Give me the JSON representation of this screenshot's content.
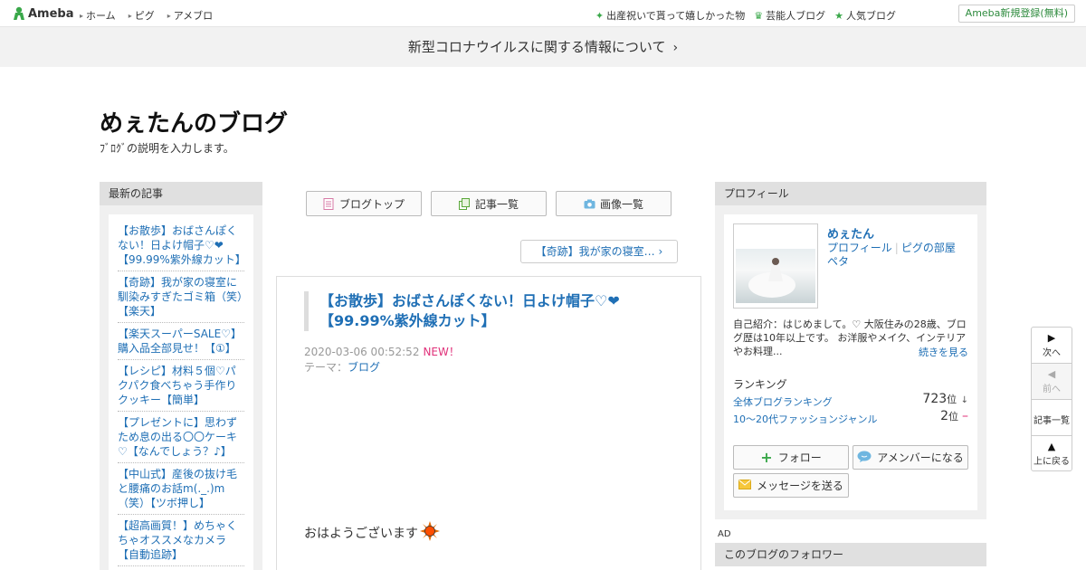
{
  "header": {
    "logo_text": "Ameba",
    "nav": [
      "ホーム",
      "ピグ",
      "アメブロ"
    ],
    "links": [
      "出産祝いで貰って嬉しかった物",
      "芸能人ブログ",
      "人気ブログ"
    ],
    "register_label": "Ameba新規登録(無料)"
  },
  "notice": {
    "text": "新型コロナウイルスに関する情報について",
    "chevron": "›"
  },
  "blog": {
    "title": "めぇたんのブログ",
    "description": "ﾌﾞﾛｸﾞの説明を入力します。"
  },
  "left": {
    "heading": "最新の記事",
    "entries": [
      "【お散歩】おばさんぽくない！日よけ帽子♡❤【99.99%紫外線カット】",
      "【奇跡】我が家の寝室に馴染みすぎたゴミ箱（笑）【楽天】",
      "【楽天スーパーSALE♡】購入品全部見せ！【①】",
      "【レシピ】材料５個♡パクパク食べちゃう手作りクッキー【簡単】",
      "【プレゼントに】思わずため息の出る〇〇ケーキ♡【なんでしょう？♪】",
      "【中山式】産後の抜け毛と腰痛のお話m(._.)m（笑）【ツボ押し】",
      "【超高画質！】めちゃくちゃオススメなカメラ【自動追跡】"
    ]
  },
  "tabs": {
    "top": "ブログトップ",
    "list": "記事一覧",
    "images": "画像一覧"
  },
  "prev_post": "【奇跡】我が家の寝室…",
  "article": {
    "title": "【お散歩】おばさんぽくない！日よけ帽子♡❤【99.99%紫外線カット】",
    "date": "2020-03-06 00:52:52",
    "new_badge": "NEW！",
    "theme_label": "テーマ：",
    "theme": "ブログ",
    "body": "おはようございます"
  },
  "profile": {
    "heading": "プロフィール",
    "name": "めぇたん",
    "link_profile": "プロフィール",
    "link_pigg": "ピグの部屋",
    "link_beta": "ペタ",
    "intro": "自己紹介：はじめまして。♡ 大阪住みの28歳、ブログ歴は10年以上です。 お洋服やメイク、インテリアやお料理...",
    "more": "続きを見る",
    "ranking_heading": "ランキング",
    "rankings": [
      {
        "label": "全体ブログランキング",
        "value": "723",
        "unit": "位",
        "trend": "↓"
      },
      {
        "label": "10〜20代ファッションジャンル",
        "value": "2",
        "unit": "位",
        "trend": "–"
      }
    ],
    "follow": "フォロー",
    "amember": "アメンバーになる",
    "message": "メッセージを送る"
  },
  "ad_label": "AD",
  "followers_heading": "このブログのフォロワー",
  "sidenav": {
    "next": "次へ",
    "prev": "前へ",
    "list": "記事一覧",
    "top": "上に戻る"
  },
  "colors": {
    "link": "#1f6fb5",
    "accent_green": "#3aa84a",
    "new_pink": "#e0317a"
  }
}
